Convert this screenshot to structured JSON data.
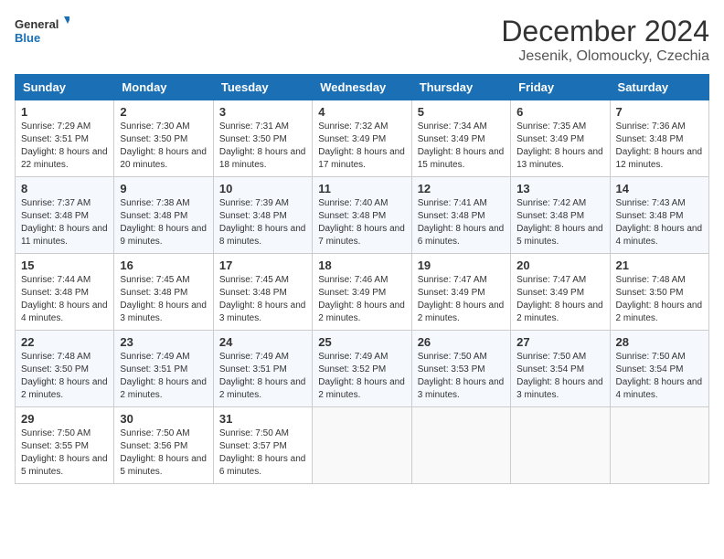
{
  "header": {
    "logo_general": "General",
    "logo_blue": "Blue",
    "month": "December 2024",
    "location": "Jesenik, Olomoucky, Czechia"
  },
  "days_of_week": [
    "Sunday",
    "Monday",
    "Tuesday",
    "Wednesday",
    "Thursday",
    "Friday",
    "Saturday"
  ],
  "weeks": [
    [
      {
        "day": "1",
        "sunrise": "7:29 AM",
        "sunset": "3:51 PM",
        "daylight": "8 hours and 22 minutes."
      },
      {
        "day": "2",
        "sunrise": "7:30 AM",
        "sunset": "3:50 PM",
        "daylight": "8 hours and 20 minutes."
      },
      {
        "day": "3",
        "sunrise": "7:31 AM",
        "sunset": "3:50 PM",
        "daylight": "8 hours and 18 minutes."
      },
      {
        "day": "4",
        "sunrise": "7:32 AM",
        "sunset": "3:49 PM",
        "daylight": "8 hours and 17 minutes."
      },
      {
        "day": "5",
        "sunrise": "7:34 AM",
        "sunset": "3:49 PM",
        "daylight": "8 hours and 15 minutes."
      },
      {
        "day": "6",
        "sunrise": "7:35 AM",
        "sunset": "3:49 PM",
        "daylight": "8 hours and 13 minutes."
      },
      {
        "day": "7",
        "sunrise": "7:36 AM",
        "sunset": "3:48 PM",
        "daylight": "8 hours and 12 minutes."
      }
    ],
    [
      {
        "day": "8",
        "sunrise": "7:37 AM",
        "sunset": "3:48 PM",
        "daylight": "8 hours and 11 minutes."
      },
      {
        "day": "9",
        "sunrise": "7:38 AM",
        "sunset": "3:48 PM",
        "daylight": "8 hours and 9 minutes."
      },
      {
        "day": "10",
        "sunrise": "7:39 AM",
        "sunset": "3:48 PM",
        "daylight": "8 hours and 8 minutes."
      },
      {
        "day": "11",
        "sunrise": "7:40 AM",
        "sunset": "3:48 PM",
        "daylight": "8 hours and 7 minutes."
      },
      {
        "day": "12",
        "sunrise": "7:41 AM",
        "sunset": "3:48 PM",
        "daylight": "8 hours and 6 minutes."
      },
      {
        "day": "13",
        "sunrise": "7:42 AM",
        "sunset": "3:48 PM",
        "daylight": "8 hours and 5 minutes."
      },
      {
        "day": "14",
        "sunrise": "7:43 AM",
        "sunset": "3:48 PM",
        "daylight": "8 hours and 4 minutes."
      }
    ],
    [
      {
        "day": "15",
        "sunrise": "7:44 AM",
        "sunset": "3:48 PM",
        "daylight": "8 hours and 4 minutes."
      },
      {
        "day": "16",
        "sunrise": "7:45 AM",
        "sunset": "3:48 PM",
        "daylight": "8 hours and 3 minutes."
      },
      {
        "day": "17",
        "sunrise": "7:45 AM",
        "sunset": "3:48 PM",
        "daylight": "8 hours and 3 minutes."
      },
      {
        "day": "18",
        "sunrise": "7:46 AM",
        "sunset": "3:49 PM",
        "daylight": "8 hours and 2 minutes."
      },
      {
        "day": "19",
        "sunrise": "7:47 AM",
        "sunset": "3:49 PM",
        "daylight": "8 hours and 2 minutes."
      },
      {
        "day": "20",
        "sunrise": "7:47 AM",
        "sunset": "3:49 PM",
        "daylight": "8 hours and 2 minutes."
      },
      {
        "day": "21",
        "sunrise": "7:48 AM",
        "sunset": "3:50 PM",
        "daylight": "8 hours and 2 minutes."
      }
    ],
    [
      {
        "day": "22",
        "sunrise": "7:48 AM",
        "sunset": "3:50 PM",
        "daylight": "8 hours and 2 minutes."
      },
      {
        "day": "23",
        "sunrise": "7:49 AM",
        "sunset": "3:51 PM",
        "daylight": "8 hours and 2 minutes."
      },
      {
        "day": "24",
        "sunrise": "7:49 AM",
        "sunset": "3:51 PM",
        "daylight": "8 hours and 2 minutes."
      },
      {
        "day": "25",
        "sunrise": "7:49 AM",
        "sunset": "3:52 PM",
        "daylight": "8 hours and 2 minutes."
      },
      {
        "day": "26",
        "sunrise": "7:50 AM",
        "sunset": "3:53 PM",
        "daylight": "8 hours and 3 minutes."
      },
      {
        "day": "27",
        "sunrise": "7:50 AM",
        "sunset": "3:54 PM",
        "daylight": "8 hours and 3 minutes."
      },
      {
        "day": "28",
        "sunrise": "7:50 AM",
        "sunset": "3:54 PM",
        "daylight": "8 hours and 4 minutes."
      }
    ],
    [
      {
        "day": "29",
        "sunrise": "7:50 AM",
        "sunset": "3:55 PM",
        "daylight": "8 hours and 5 minutes."
      },
      {
        "day": "30",
        "sunrise": "7:50 AM",
        "sunset": "3:56 PM",
        "daylight": "8 hours and 5 minutes."
      },
      {
        "day": "31",
        "sunrise": "7:50 AM",
        "sunset": "3:57 PM",
        "daylight": "8 hours and 6 minutes."
      },
      null,
      null,
      null,
      null
    ]
  ],
  "labels": {
    "sunrise": "Sunrise:",
    "sunset": "Sunset:",
    "daylight": "Daylight:"
  }
}
